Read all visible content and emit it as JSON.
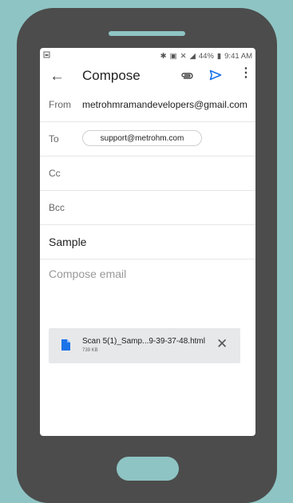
{
  "status": {
    "time": "9:41 AM",
    "battery": "44%"
  },
  "appbar": {
    "title": "Compose"
  },
  "fields": {
    "from_label": "From",
    "from_value": "metrohmramandevelopers@gmail.com",
    "to_label": "To",
    "to_chip": "support@metrohm.com",
    "cc_label": "Cc",
    "bcc_label": "Bcc",
    "subject": "Sample",
    "body_placeholder": "Compose email"
  },
  "attachment": {
    "name": "Scan 5(1)_Samp...9-39-37-48.html",
    "size": "739 KB"
  },
  "colors": {
    "accent": "#1a73e8",
    "background": "#8fc4c4",
    "phone": "#4c4c4c"
  }
}
